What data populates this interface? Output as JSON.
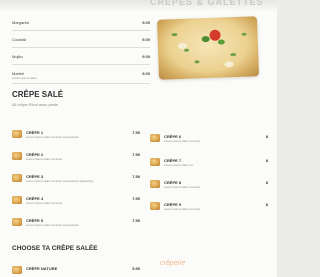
{
  "header": {
    "banner_text": "CRÊPES & GALETTES"
  },
  "drinks": [
    {
      "name": "Margarita",
      "desc": "",
      "price": "9.00"
    },
    {
      "name": "Cocktail",
      "desc": "",
      "price": "9.00"
    },
    {
      "name": "Mojito",
      "desc": "",
      "price": "9.00"
    },
    {
      "name": "Martini",
      "desc": "Lorem ipsum dolor",
      "price": "9.00"
    }
  ],
  "crepe_sale": {
    "title": "CRÊPE SALÉ",
    "subtitle": "All crêpe Ricot avec pieds",
    "left_items": [
      {
        "name": "CRÊPE 1",
        "desc": "Lorem ipsum dolor sit amet consectetur",
        "price": "7.50"
      },
      {
        "name": "CRÊPE 2",
        "desc": "Lorem ipsum dolor sit amet",
        "price": "7.50"
      },
      {
        "name": "CRÊPE 3",
        "desc": "Lorem ipsum dolor sit amet consectetur adipiscing",
        "price": "7.50"
      },
      {
        "name": "CRÊPE 4",
        "desc": "Lorem ipsum dolor sit amet",
        "price": "7.50"
      },
      {
        "name": "CRÊPE 5",
        "desc": "Lorem ipsum dolor sit amet consectetur",
        "price": "7.50"
      }
    ],
    "right_items": [
      {
        "name": "CRÊPE 6",
        "desc": "Lorem ipsum dolor sit amet",
        "price": "8"
      },
      {
        "name": "CRÊPE 7",
        "desc": "Lorem ipsum dolor sit",
        "price": "8"
      },
      {
        "name": "CRÊPE 8",
        "desc": "Lorem ipsum dolor sit amet",
        "price": "8"
      },
      {
        "name": "CRÊPE 9",
        "desc": "Lorem ipsum dolor sit amet",
        "price": "8"
      }
    ]
  },
  "choose_section": {
    "title": "CHOOSE TA CRÊPE SALÉE",
    "first_item": {
      "name": "CRÊPE NATURE",
      "price": "5.50"
    }
  },
  "brand": {
    "name": "crêperie"
  }
}
